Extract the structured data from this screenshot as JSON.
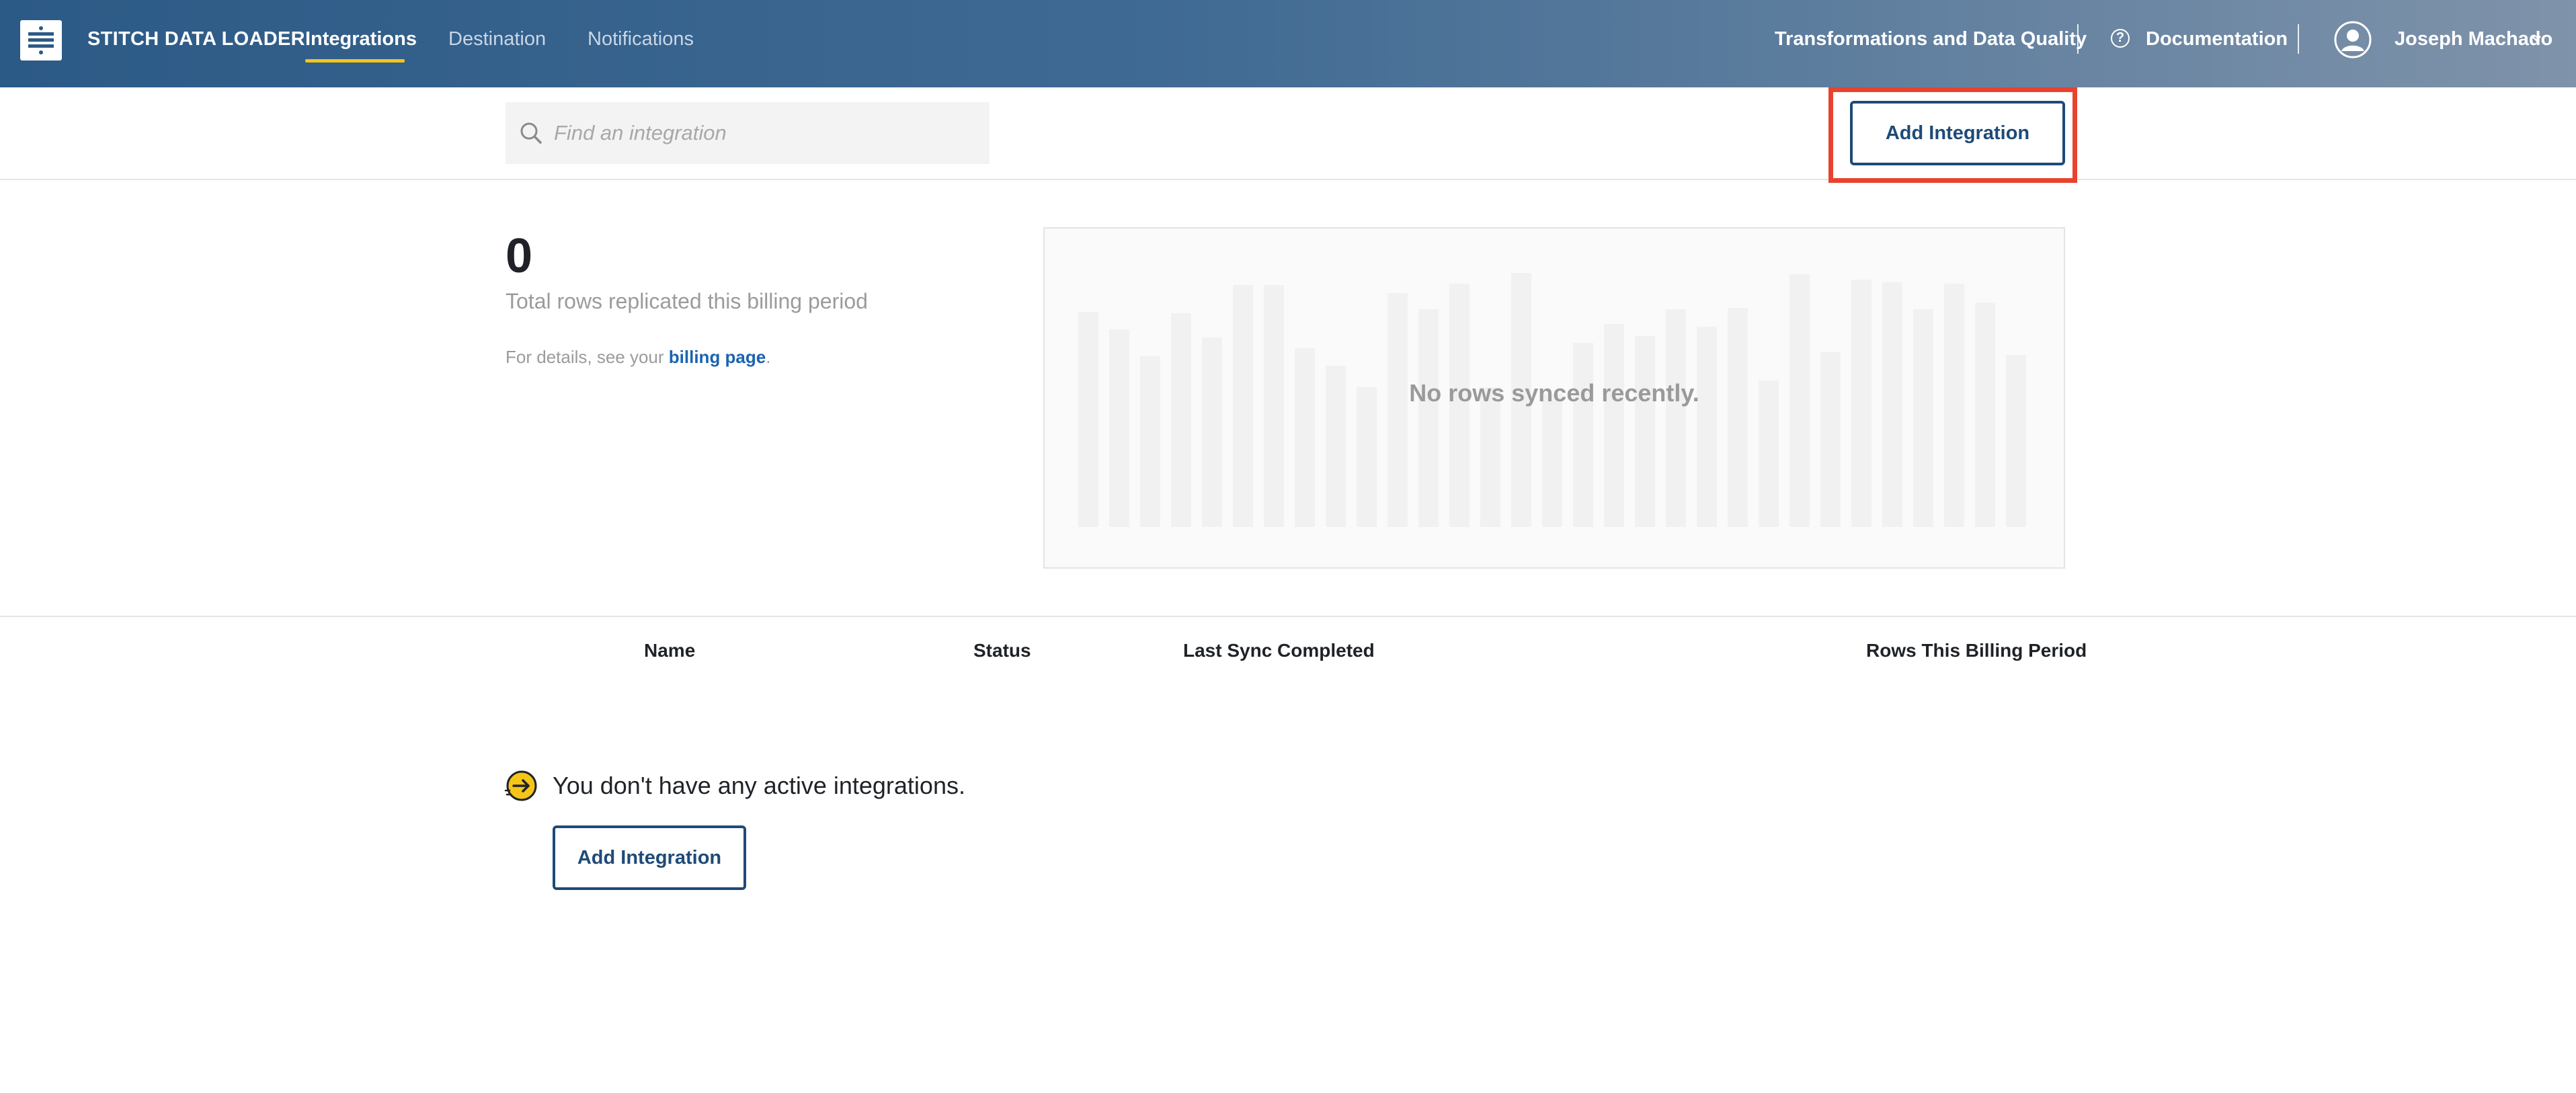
{
  "app": {
    "brand": "STITCH DATA LOADER"
  },
  "nav": {
    "tabs": [
      {
        "label": "Integrations",
        "active": true
      },
      {
        "label": "Destination",
        "active": false
      },
      {
        "label": "Notifications",
        "active": false
      }
    ],
    "right": {
      "transformations": "Transformations and Data Quality",
      "documentation": "Documentation",
      "user": "Joseph Machado"
    }
  },
  "search": {
    "placeholder": "Find an integration",
    "value": ""
  },
  "toolbar": {
    "add_label": "Add Integration"
  },
  "summary": {
    "total": "0",
    "total_label": "Total rows replicated this billing period",
    "details_prefix": "For details, see your ",
    "details_link": "billing page",
    "details_suffix": "."
  },
  "chart": {
    "empty_message": "No rows synced recently."
  },
  "table": {
    "columns": [
      "Name",
      "Status",
      "Last Sync Completed",
      "Rows This Billing Period"
    ]
  },
  "empty_state": {
    "message": "You don't have any active integrations.",
    "button_label": "Add Integration"
  },
  "colors": {
    "accent": "#1e4a78",
    "nav_underline": "#f5c518",
    "highlight": "#e8432e",
    "link": "#1b63b0"
  }
}
